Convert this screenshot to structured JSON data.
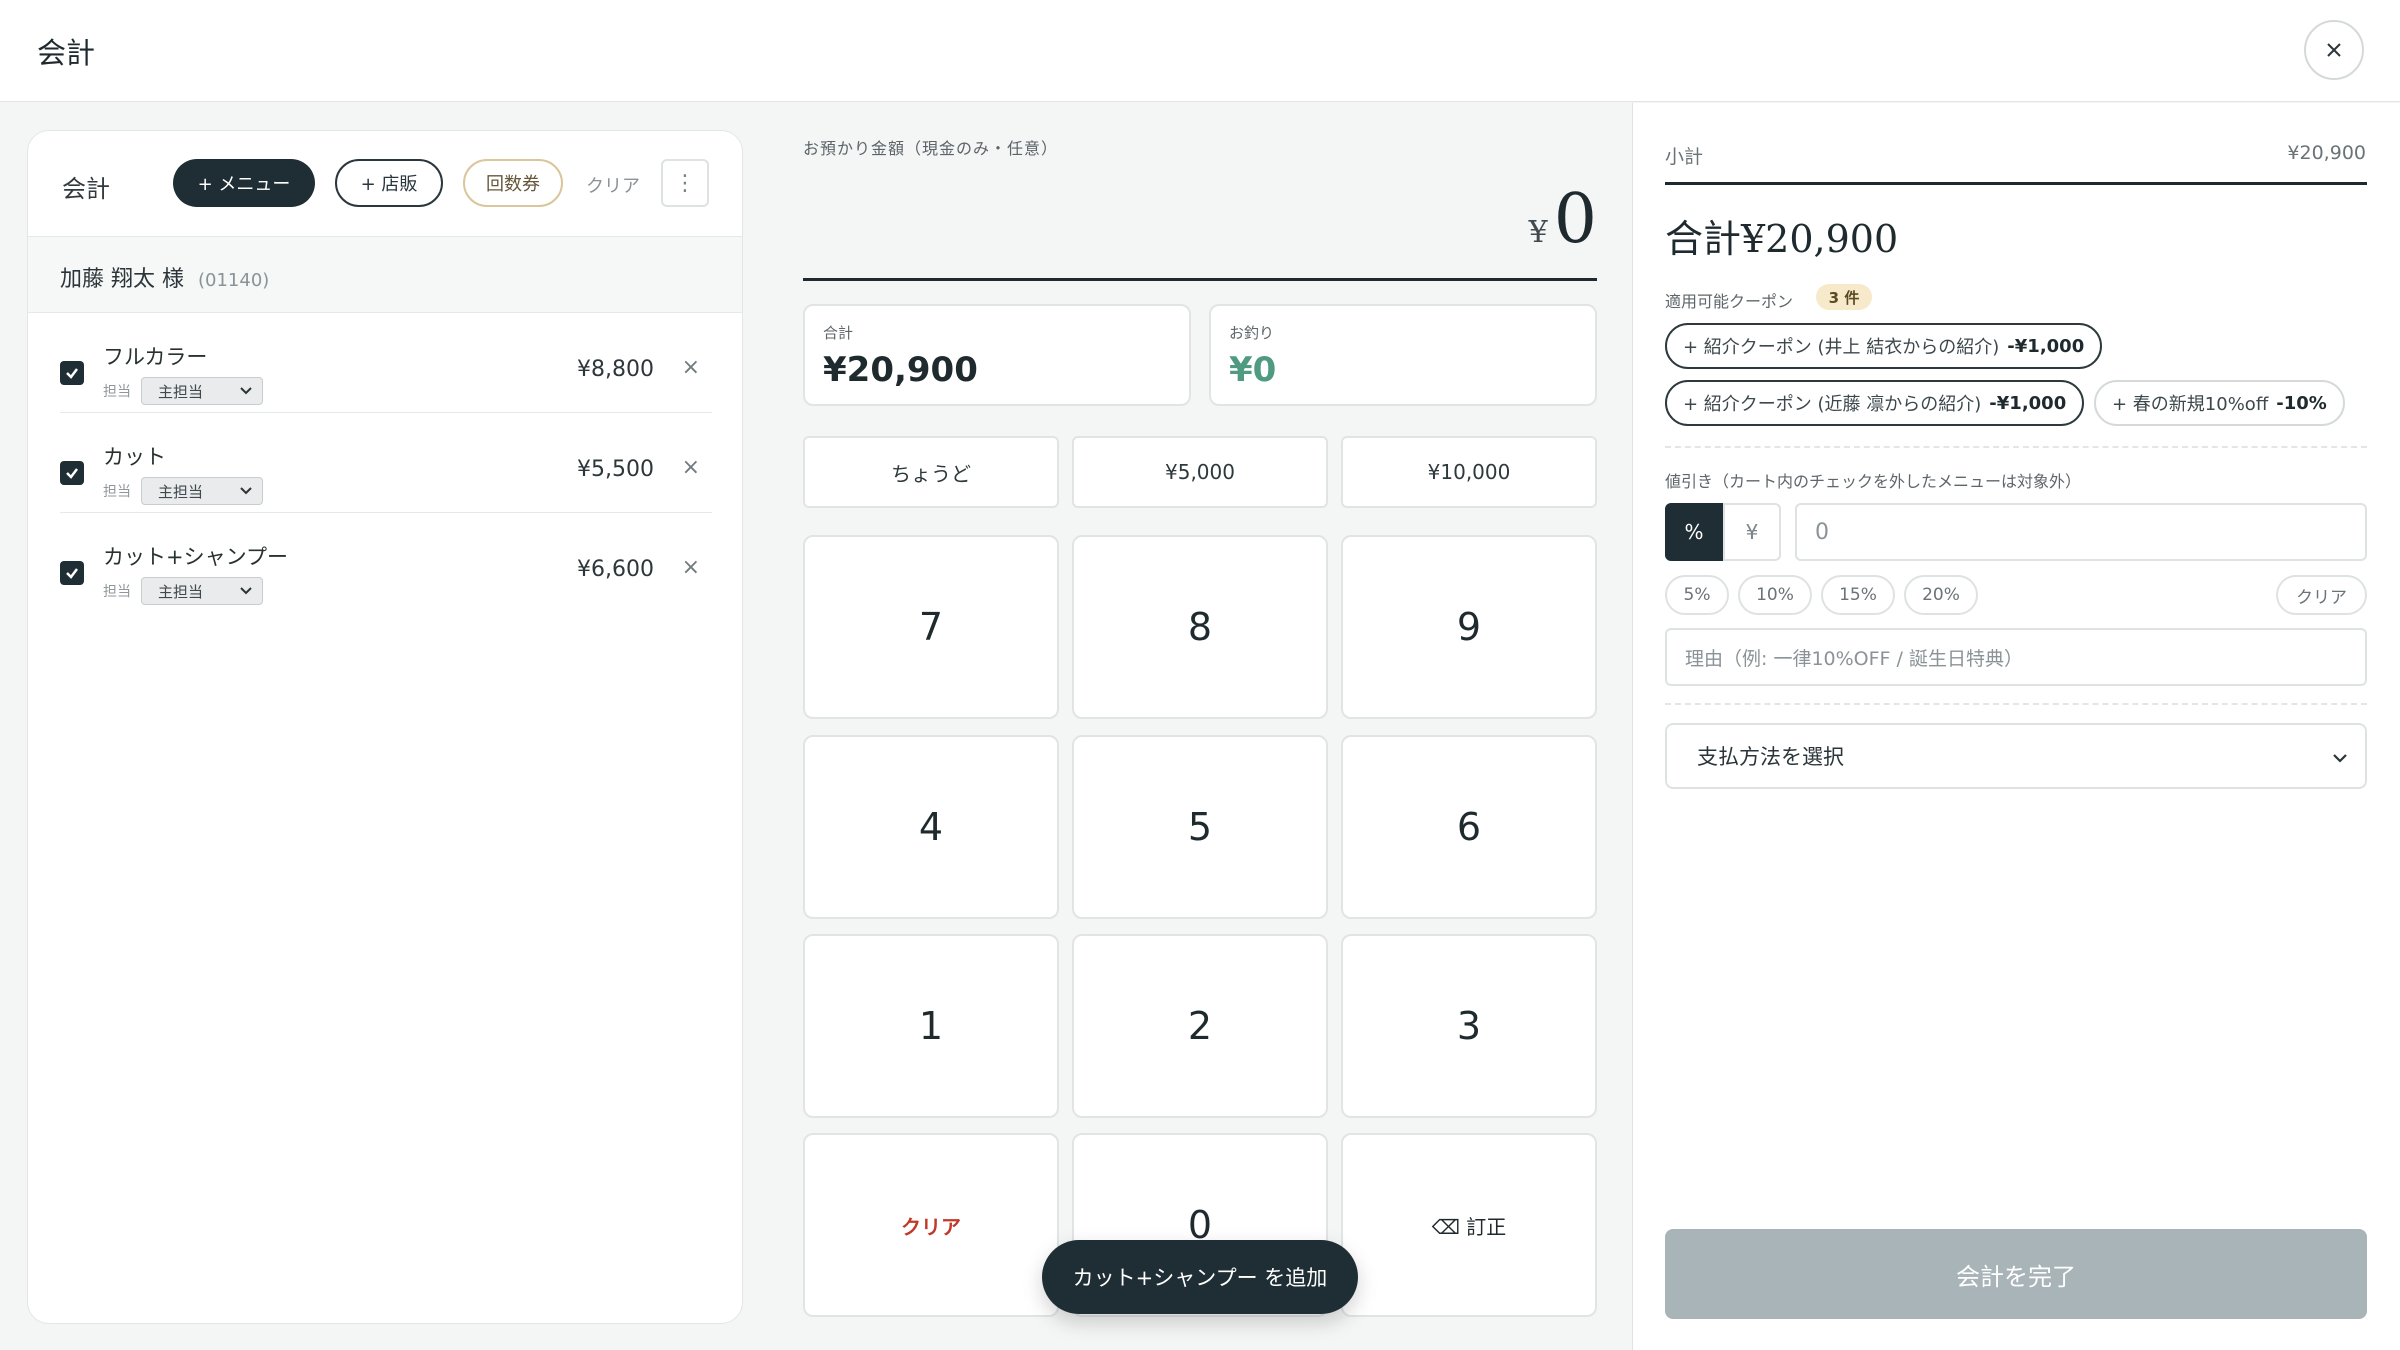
{
  "header": {
    "title": "会計"
  },
  "cart": {
    "label": "会計",
    "menu_button": "+ メニュー",
    "retail_button": "+ 店販",
    "ticket_button": "回数券",
    "clear_link": "クリア",
    "customer": {
      "name": "加藤 翔太 様",
      "number": "(01140)"
    },
    "staff_label": "担当",
    "items": [
      {
        "name": "フルカラー",
        "staff": "主担当",
        "price": "¥8,800"
      },
      {
        "name": "カット",
        "staff": "主担当",
        "price": "¥5,500"
      },
      {
        "name": "カット+シャンプー",
        "staff": "主担当",
        "price": "¥6,600"
      }
    ]
  },
  "register": {
    "deposit_label": "お預かり金額（現金のみ・任意）",
    "currency": "¥",
    "deposit_value": "0",
    "total_label": "合計",
    "total_value": "¥20,900",
    "change_label": "お釣り",
    "change_value": "¥0",
    "quick": [
      "ちょうど",
      "¥5,000",
      "¥10,000"
    ],
    "keys": [
      "7",
      "8",
      "9",
      "4",
      "5",
      "6",
      "1",
      "2",
      "3"
    ],
    "key_clear": "クリア",
    "key_zero": "0",
    "key_correct": "⌫ 訂正",
    "toast": "カット+シャンプー を追加"
  },
  "summary": {
    "subtotal_label": "小計",
    "subtotal_value": "¥20,900",
    "total_text": "合計¥20,900",
    "coupon_label": "適用可能クーポン",
    "coupon_count": "3 件",
    "coupons": [
      {
        "text": "+ 紹介クーポン (井上 結衣からの紹介)",
        "value": "-¥1,000"
      },
      {
        "text": "+ 紹介クーポン (近藤 凛からの紹介)",
        "value": "-¥1,000"
      },
      {
        "text": "+ 春の新規10%off",
        "value": "-10%"
      }
    ],
    "discount_label": "値引き（カート内のチェックを外したメニューは対象外）",
    "mode_percent": "%",
    "mode_yen": "¥",
    "discount_value": "0",
    "chips": [
      "5%",
      "10%",
      "15%",
      "20%"
    ],
    "chip_clear": "クリア",
    "reason_placeholder": "理由（例: 一律10%OFF / 誕生日特典）",
    "payment_select": "支払方法を選択",
    "complete_button": "会計を完了"
  }
}
